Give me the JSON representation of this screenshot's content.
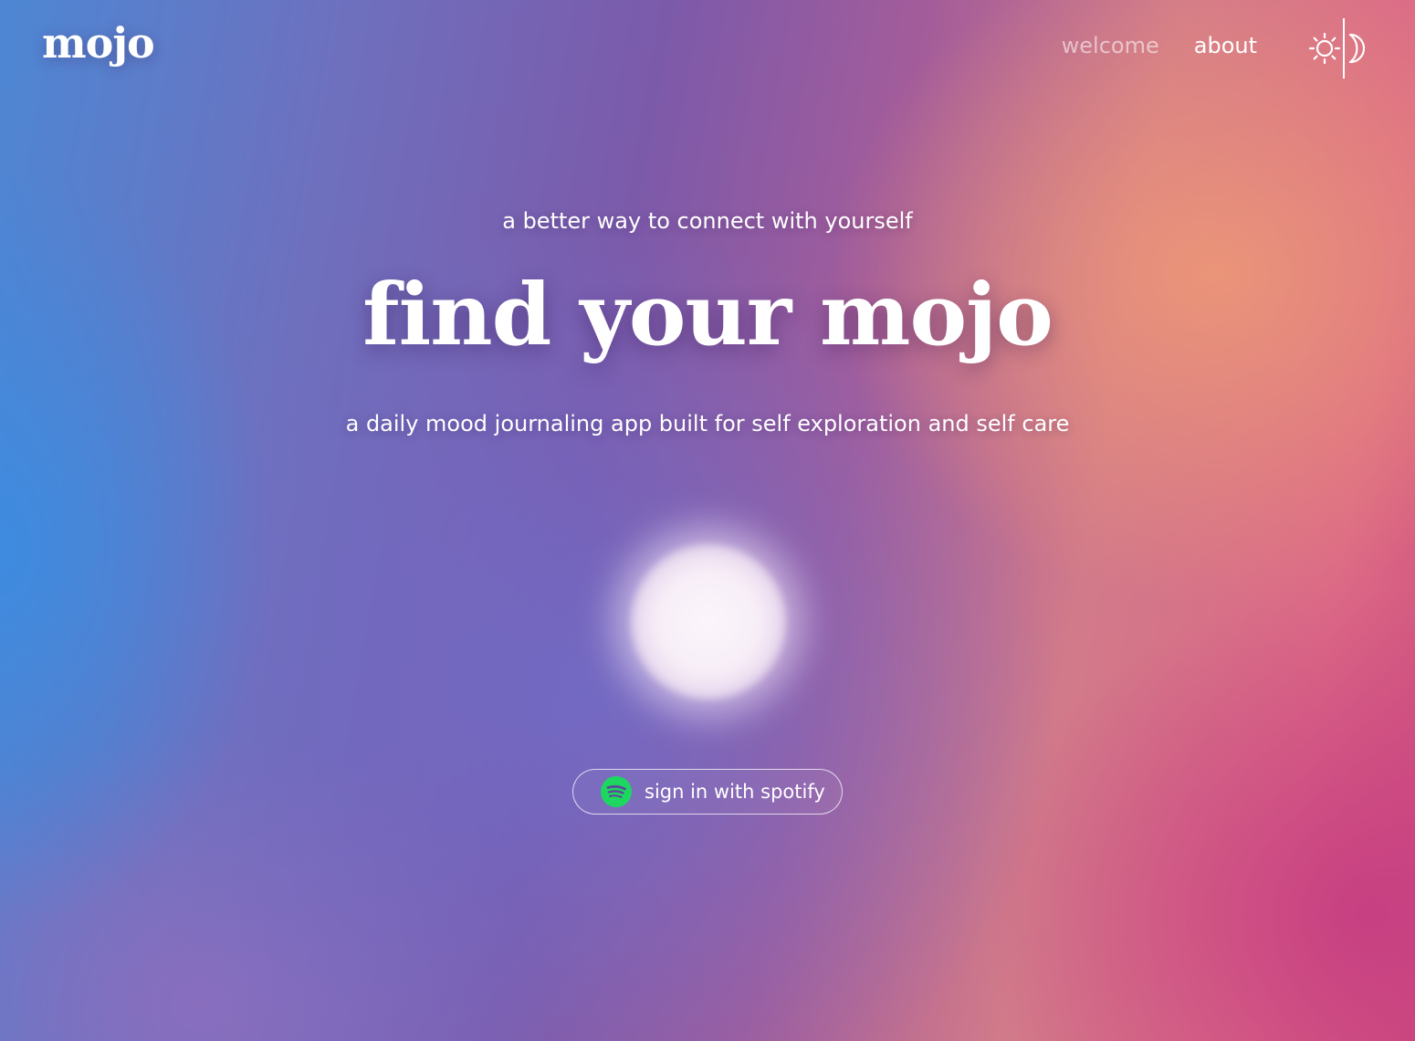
{
  "header": {
    "logo": "mojo",
    "nav": [
      {
        "label": "welcome",
        "active": false
      },
      {
        "label": "about",
        "active": true
      }
    ],
    "theme_toggle": {
      "icons": [
        "sun-icon",
        "moon-icon"
      ]
    }
  },
  "hero": {
    "tagline": "a better way to connect with yourself",
    "title": "find your mojo",
    "description": "a daily mood journaling app built for self exploration and self care"
  },
  "signin": {
    "label": "sign in with spotify",
    "icon": "spotify-icon",
    "icon_color": "#1ed760"
  },
  "colors": {
    "gradient_left": "#4d87d4",
    "gradient_center": "#7c5aaa",
    "gradient_right": "#dc6a86",
    "gradient_bottom_right": "#c63e82",
    "text": "#ffffff"
  }
}
